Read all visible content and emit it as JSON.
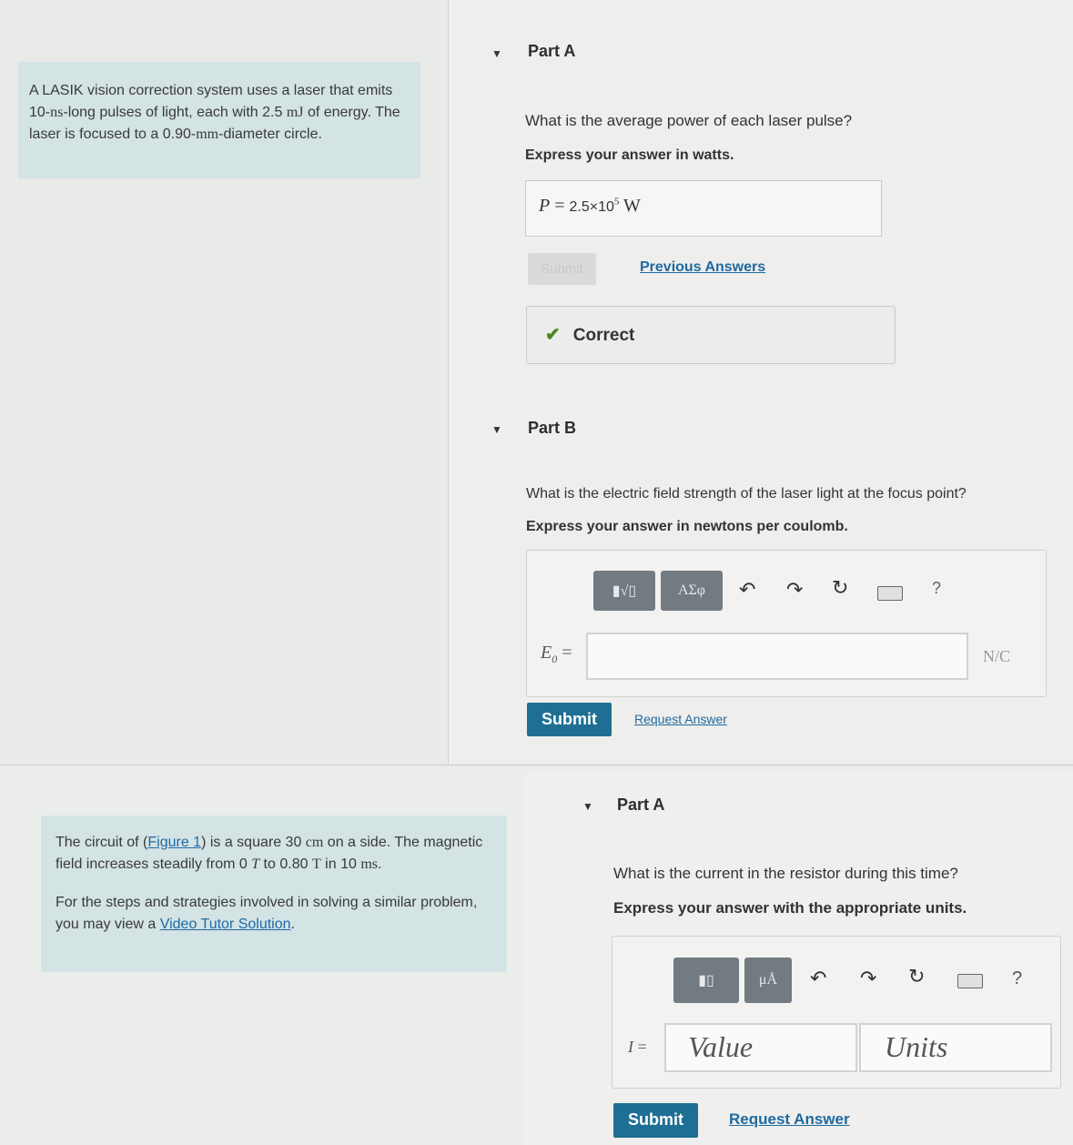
{
  "problem1": {
    "text_1": "A LASIK vision correction system uses a laser that emits 10-",
    "unit_ns": "ns",
    "text_2": "-long pulses of light, each with 2.5 ",
    "unit_mJ": "mJ",
    "text_3": " of energy. The laser is focused to a ",
    "value_diam": "0.90-",
    "unit_mm": "mm",
    "text_4": "-diameter circle."
  },
  "partA1": {
    "caret": "▼",
    "title": "Part A",
    "question": "What is the average power of each laser pulse?",
    "instruction": "Express your answer in watts.",
    "answer_var": "P",
    "answer_eq": " = ",
    "answer_value": "2.5×10",
    "answer_exp": "5",
    "answer_unit": "W",
    "submit_label": "Submit",
    "previous_answers": "Previous Answers",
    "feedback": "Correct",
    "check_icon": "check-icon"
  },
  "partB": {
    "caret": "▼",
    "title": "Part B",
    "question": "What is the electric field strength of the laser light at the focus point?",
    "instruction": "Express your answer in newtons per coulomb.",
    "tool_templates": "▮√▯",
    "tool_symbols": "ΑΣφ",
    "undo": "↶",
    "redo": "↷",
    "reset": "↻",
    "help": "?",
    "label": "E",
    "label_sub": "0",
    "label_eq": " =",
    "units": "N/C",
    "submit_label": "Submit",
    "request_answer": "Request Answer"
  },
  "problem2": {
    "text_1": "The circuit of (",
    "figure_link": "Figure 1",
    "text_2": ") is a square 30 ",
    "unit_cm": "cm",
    "text_3": " on a side. The magnetic field increases steadily from 0 ",
    "unit_T1": "T",
    "text_4": " to 0.80 ",
    "unit_T2": "T",
    "text_5": " in 10 ",
    "unit_ms": "ms",
    "text_6": ".",
    "steps_1": "For the steps and strategies involved in solving a similar problem, you may view a ",
    "video_link": "Video Tutor Solution",
    "steps_2": "."
  },
  "partA2": {
    "caret": "▼",
    "title": "Part A",
    "question": "What is the current in the resistor during this time?",
    "instruction": "Express your answer with the appropriate units.",
    "tool_templates": "▮▯",
    "tool_units": "μÅ",
    "undo": "↶",
    "redo": "↷",
    "reset": "↻",
    "help": "?",
    "label": "I",
    "label_eq": " =",
    "value_placeholder": "Value",
    "units_placeholder": "Units",
    "submit_label": "Submit",
    "request_answer": "Request Answer"
  },
  "colors": {
    "info_bg": "#d4e3e4",
    "submit_bg": "#1f6f94",
    "link": "#1f6aa0",
    "check": "#4a8a22"
  }
}
